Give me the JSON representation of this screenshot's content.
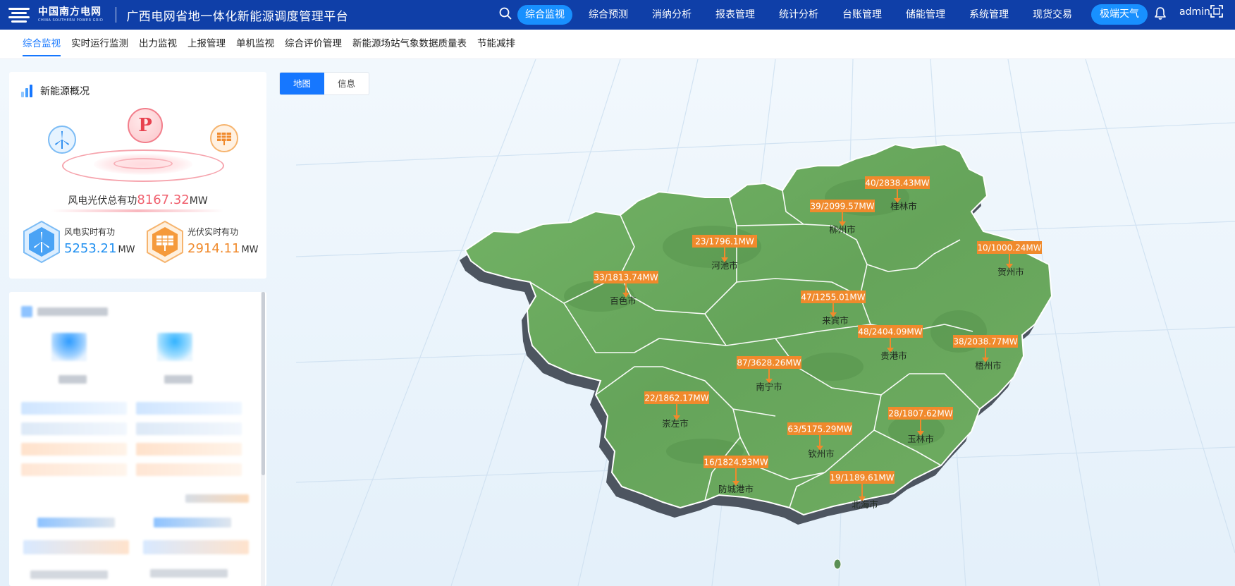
{
  "header": {
    "logo_cn": "中国南方电网",
    "logo_en": "CHINA SOUTHERN POWER GRID",
    "title": "广西电网省地一体化新能源调度管理平台",
    "nav": [
      "综合监视",
      "综合预测",
      "消纳分析",
      "报表管理",
      "统计分析",
      "台账管理",
      "储能管理",
      "系统管理",
      "现货交易"
    ],
    "active_nav": "综合监视",
    "weather_label": "极端天气",
    "user": "admin",
    "icons": [
      "search-icon",
      "bell-icon",
      "fullscreen-icon"
    ]
  },
  "subnav": {
    "items": [
      "综合监视",
      "实时运行监测",
      "出力监视",
      "上报管理",
      "单机监视",
      "综合评价管理",
      "新能源场站气象数据质量表",
      "节能减排"
    ],
    "active": "综合监视"
  },
  "overview": {
    "title": "新能源概况",
    "center_icon": "P",
    "total_label": "风电光伏总有功",
    "total_value": "8167.32",
    "total_unit": "MW",
    "wind_label": "风电实时有功",
    "wind_value": "5253.21",
    "wind_unit": "MW",
    "solar_label": "光伏实时有功",
    "solar_value": "2914.11",
    "solar_unit": "MW"
  },
  "map_tabs": [
    "地图",
    "信息"
  ],
  "active_map_tab": "地图",
  "colors": {
    "topbar": "#0f3fa8",
    "accent": "#1890ff",
    "label_bg": "#f08a2c",
    "wind": "#1f8ff0",
    "solar": "#f08a2c",
    "total": "#f0616f",
    "land": "#6aa85e"
  },
  "cities": [
    {
      "name": "桂林市",
      "mw": "40/2838.43MW"
    },
    {
      "name": "柳州市",
      "mw": "39/2099.57MW"
    },
    {
      "name": "河池市",
      "mw": "23/1796.1MW"
    },
    {
      "name": "贺州市",
      "mw": "10/1000.24MW"
    },
    {
      "name": "百色市",
      "mw": "33/1813.74MW"
    },
    {
      "name": "来宾市",
      "mw": "47/1255.01MW"
    },
    {
      "name": "贵港市",
      "mw": "48/2404.09MW"
    },
    {
      "name": "梧州市",
      "mw": "38/2038.77MW"
    },
    {
      "name": "南宁市",
      "mw": "87/3628.26MW"
    },
    {
      "name": "崇左市",
      "mw": "22/1862.17MW"
    },
    {
      "name": "玉林市",
      "mw": "28/1807.62MW"
    },
    {
      "name": "钦州市",
      "mw": "63/5175.29MW"
    },
    {
      "name": "防城港市",
      "mw": "16/1824.93MW"
    },
    {
      "name": "北海市",
      "mw": "19/1189.61MW"
    }
  ]
}
